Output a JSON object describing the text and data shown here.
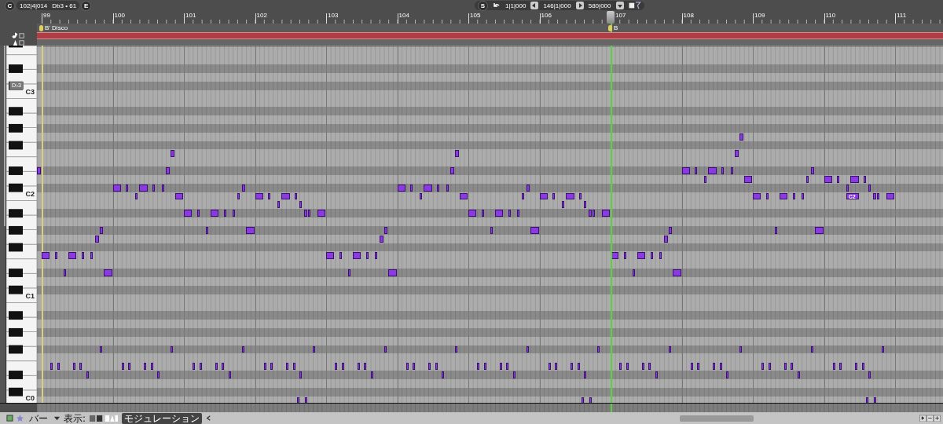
{
  "toolbar_left": {
    "left_button": "C",
    "position": "102|4|014",
    "pitch": "Db3 • 61",
    "right_button": "E"
  },
  "toolbar_center": {
    "left_button": "S",
    "start": "1|1|000",
    "end": "146|1|000",
    "length": "580|000"
  },
  "ruler": {
    "bars": [
      "99",
      "100",
      "101",
      "102",
      "103",
      "104",
      "105",
      "106",
      "107",
      "108",
      "109",
      "110",
      "111"
    ]
  },
  "markers": [
    {
      "text": "B' Disco"
    },
    {
      "text": "B"
    }
  ],
  "keyboard": {
    "octave_labels": [
      "C3",
      "C2",
      "C1",
      "C0"
    ],
    "highlight_label": "D♭3"
  },
  "note_label": "C2",
  "bottom_bar": {
    "view_menu": "バー",
    "show_label": "表示:",
    "controller_menu": "モジュレーション"
  }
}
